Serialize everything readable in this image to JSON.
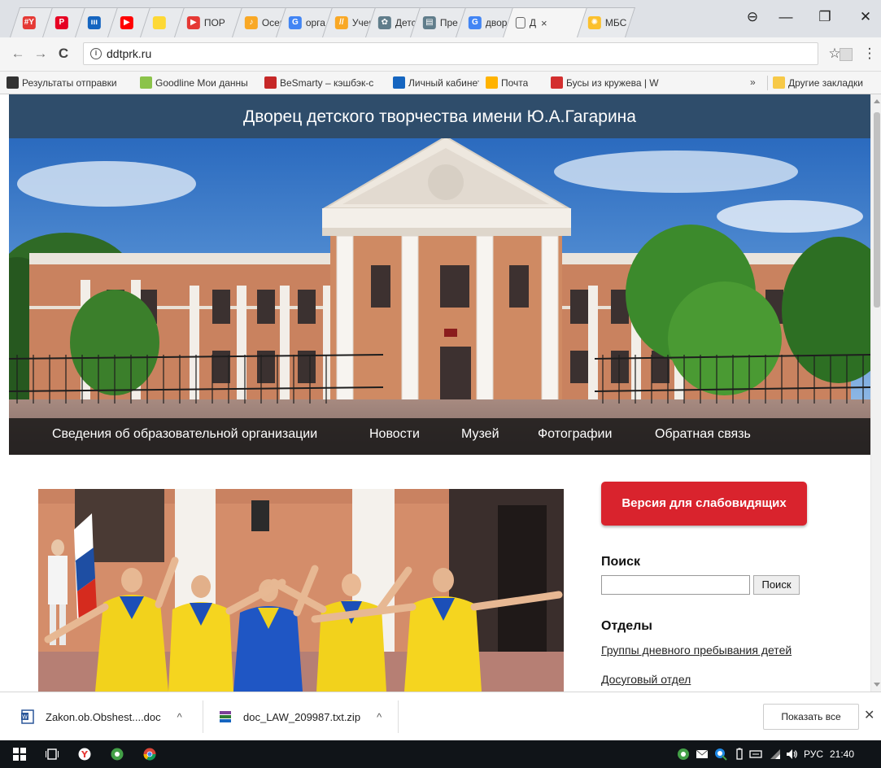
{
  "browser": {
    "tabs": [
      {
        "label": "",
        "favicon_text": "#Y",
        "color": "#e53935"
      },
      {
        "label": "",
        "favicon_text": "P",
        "color": "#e60023"
      },
      {
        "label": "",
        "favicon_text": "ııı",
        "color": "#1565c0"
      },
      {
        "label": "",
        "favicon_text": "▶",
        "color": "#ff0000"
      },
      {
        "label": "",
        "favicon_text": "",
        "color": "#fdd835"
      },
      {
        "label": "ПОР",
        "favicon_text": "▶",
        "color": "#e53935"
      },
      {
        "label": "Осен",
        "favicon_text": "♪",
        "color": "#f9a825"
      },
      {
        "label": "орга",
        "favicon_text": "G",
        "color": "#4285f4"
      },
      {
        "label": "Учен",
        "favicon_text": "//",
        "color": "#f9a825"
      },
      {
        "label": "Детс",
        "favicon_text": "✿",
        "color": "#607d8b"
      },
      {
        "label": "Пре",
        "favicon_text": "▤",
        "color": "#607d8b"
      },
      {
        "label": "двор",
        "favicon_text": "G",
        "color": "#4285f4"
      },
      {
        "label": "Д",
        "favicon_text": "",
        "color": "#888888",
        "active": true
      },
      {
        "label": "МБС",
        "favicon_text": "✺",
        "color": "#fbc02d"
      }
    ],
    "active_tab_close": "×",
    "window_controls": {
      "profile": "⊖",
      "minimize": "—",
      "maximize": "❐",
      "close": "✕"
    },
    "nav": {
      "back": "←",
      "forward": "→",
      "reload": "C"
    },
    "url": "ddtprk.ru",
    "star": "☆",
    "menu": "⋮",
    "bookmarks": [
      {
        "label": "Результаты отправки",
        "color": "#333333"
      },
      {
        "label": "Goodline Мои данны",
        "color": "#8bc34a"
      },
      {
        "label": "BeSmarty – кэшбэк-с",
        "color": "#c62828"
      },
      {
        "label": "Личный кабинет",
        "color": "#1565c0"
      },
      {
        "label": "Почта",
        "color": "#ffb300"
      },
      {
        "label": "Бусы из кружева | W",
        "color": "#d32f2f"
      }
    ],
    "bookmarks_more": "»",
    "other_bookmarks": "Другие закладки"
  },
  "site": {
    "title": "Дворец детского творчества имени Ю.А.Гагарина",
    "menu": [
      "Сведения об образовательной организации",
      "Новости",
      "Музей",
      "Фотографии",
      "Обратная связь"
    ],
    "low_vision_button": "Версия для слабовидящих",
    "search_heading": "Поиск",
    "search_button": "Поиск",
    "search_value": "",
    "departments_heading": "Отделы",
    "departments": [
      "Группы дневного пребывания детей",
      "Досуговый отдел"
    ]
  },
  "downloads": {
    "items": [
      {
        "name": "Zakon.ob.Obshest....doc",
        "type": "doc"
      },
      {
        "name": "doc_LAW_209987.txt.zip",
        "type": "zip"
      }
    ],
    "chevron": "^",
    "show_all": "Показать все",
    "close": "✕"
  },
  "taskbar": {
    "lang": "РУС",
    "time": "21:40"
  }
}
